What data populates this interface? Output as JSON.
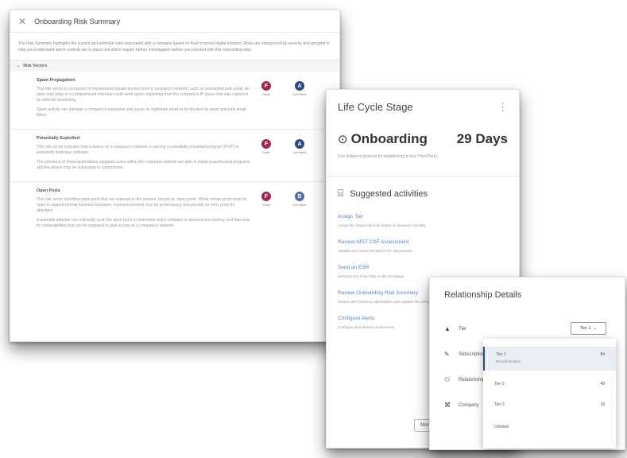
{
  "risk_panel": {
    "title": "Onboarding Risk Summary",
    "intro": "The Risk Summary highlights the current and potential risks associated with a company based on their scanned digital footprint. Risks are categorized by severity and grouped to help you understand which controls are in place and which require further investigation before you proceed with this onboarding step.",
    "section_label": "Risk Vectors",
    "risks": [
      {
        "title": "Spam Propagation",
        "desc": [
          "This risk vector is composed of reputational signals derived from a company's network, such as unsolicited bulk email. An open mail relay or a compromised machine could send spam originating from the company's IP space that was captured by external monitoring.",
          "Spam activity can damage a company's reputation and cause its legitimate email to be blocked by spam and junk email filters."
        ],
        "badges": [
          {
            "label": "Grade",
            "letter": "F",
            "color": "#a3294a"
          },
          {
            "label": "Core Metric",
            "letter": "A",
            "color": "#2c4a7e"
          }
        ]
      },
      {
        "title": "Potentially Exploited",
        "desc": [
          "This risk vector indicates that a device on a company's network is running a potentially unwanted program (PUP) or potentially malicious software.",
          "The presence of these applications suggests users within the corporate network are able to install unauthorized programs and the device may be vulnerable to compromise."
        ],
        "badges": [
          {
            "label": "Grade",
            "letter": "F",
            "color": "#a3294a"
          },
          {
            "label": "Core Metric",
            "letter": "A",
            "color": "#2c4a7e"
          }
        ]
      },
      {
        "title": "Open Ports",
        "desc": [
          "This risk vector identifies open ports that are exposed to the internet, known as 'open ports'. While certain ports must be open to support normal business functions, exposed services may be unnecessary and provide an entry point for attackers.",
          "A potential attacker can externally scan the open ports to determine which software or services are running, and then look for vulnerabilities that can be exploited to gain access to a company's network."
        ],
        "badges": [
          {
            "label": "Grade",
            "letter": "F",
            "color": "#a3294a"
          },
          {
            "label": "Core Metric",
            "letter": "B",
            "color": "#4d6fa6"
          }
        ]
      }
    ]
  },
  "lifecycle": {
    "title": "Life Cycle Stage",
    "more_icon": "⋮",
    "stage_icon": "clock-icon",
    "stage": "Onboarding",
    "days": "29 Days",
    "stage_desc": "Due diligence process for establishing a new Third Party.",
    "suggested_title": "Suggested activities",
    "activities": [
      {
        "label": "Assign Tier",
        "desc": "Assign the Tiered risk level based on business criticality."
      },
      {
        "label": "Review NIST CSF Assessment",
        "desc": "Validate and review the NIST CSF assessment."
      },
      {
        "label": "Send an ESR",
        "desc": "Welcome the Third Party to the Exchange."
      },
      {
        "label": "Review Onboarding Risk Summary",
        "desc": "Review with business stakeholders and validate the onboarding risks."
      },
      {
        "label": "Configure Alerts",
        "desc": "Configure alert delivery preferences."
      }
    ],
    "more_button": "More"
  },
  "relationship": {
    "title": "Relationship Details",
    "rows": [
      {
        "label": "Tier",
        "icon": "tier-icon"
      },
      {
        "label": "Subscription",
        "icon": "subscription-icon"
      },
      {
        "label": "Relationship",
        "icon": "relationship-icon"
      },
      {
        "label": "Company",
        "icon": "company-icon"
      }
    ],
    "tier_select": "Tier 1",
    "options": [
      {
        "label": "Tier 1",
        "sub": "Recommended",
        "count": "84"
      },
      {
        "label": "Tier 2",
        "count": "48"
      },
      {
        "label": "Tier 3",
        "count": "18"
      },
      {
        "label": "Unlisted",
        "count": ""
      }
    ]
  }
}
